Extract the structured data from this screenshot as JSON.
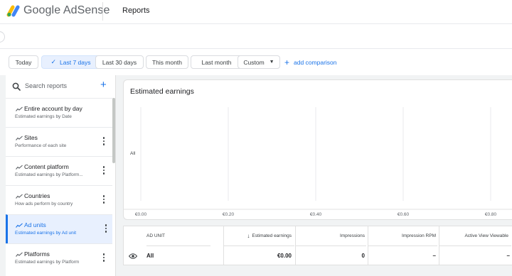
{
  "header": {
    "brand": "Google AdSense",
    "page_title": "Reports"
  },
  "date_range": {
    "options": [
      "Today",
      "Last 7 days",
      "Last 30 days",
      "This month",
      "Last month",
      "Custom"
    ],
    "selected": "Last 7 days",
    "add_comparison": "add comparison"
  },
  "sidebar": {
    "search_placeholder": "Search reports",
    "reports": [
      {
        "title": "Entire account by day",
        "subtitle": "Estimated earnings by Date"
      },
      {
        "title": "Sites",
        "subtitle": "Performance of each site"
      },
      {
        "title": "Content platform",
        "subtitle": "Estimated earnings by Platform..."
      },
      {
        "title": "Countries",
        "subtitle": "How ads perform by country"
      },
      {
        "title": "Ad units",
        "subtitle": "Estimated earnings by Ad unit",
        "active": true
      },
      {
        "title": "Platforms",
        "subtitle": "Estimated earnings by Platform"
      }
    ]
  },
  "chart_data": {
    "type": "bar",
    "title": "Estimated earnings",
    "categories": [
      "All"
    ],
    "values": [
      0
    ],
    "xlim": [
      0,
      0.8
    ],
    "x_ticks": [
      "€0.00",
      "€0.20",
      "€0.40",
      "€0.60",
      "€0.80"
    ],
    "grid": true,
    "orientation": "horizontal"
  },
  "table": {
    "columns": [
      "AD UNIT",
      "Estimated earnings",
      "Impressions",
      "Impression RPM",
      "Active View Viewable"
    ],
    "sort_column": "Estimated earnings",
    "rows": [
      {
        "ad_unit": "All",
        "estimated_earnings": "€0.00",
        "impressions": "0",
        "impression_rpm": "–",
        "active_view_viewable": "–"
      }
    ]
  },
  "colors": {
    "accent": "#1a73e8",
    "selected_bg": "#e8f0fe",
    "page_bg": "#f1f3f4"
  }
}
